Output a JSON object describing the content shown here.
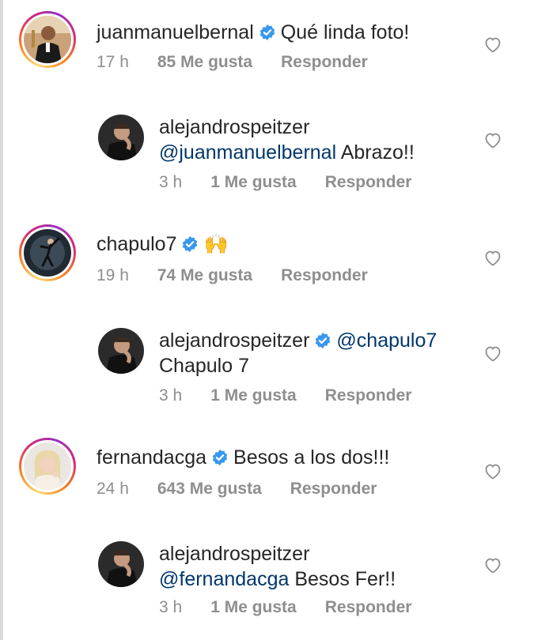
{
  "comments": [
    {
      "username": "juanmanuelbernal",
      "verified": true,
      "text": "Qué linda foto!",
      "time": "17 h",
      "likes": "85 Me gusta",
      "reply": "Responder",
      "replies": [
        {
          "username": "alejandrospeitzer",
          "verified": false,
          "mention": "@juanmanuelbernal",
          "text": "Abrazo!!",
          "time": "3 h",
          "likes": "1 Me gusta",
          "reply": "Responder"
        }
      ]
    },
    {
      "username": "chapulo7",
      "verified": true,
      "text": "🙌",
      "time": "19 h",
      "likes": "74 Me gusta",
      "reply": "Responder",
      "replies": [
        {
          "username": "alejandrospeitzer",
          "verified": true,
          "mention": "@chapulo7",
          "text": "Chapulo 7",
          "time": "3 h",
          "likes": "1 Me gusta",
          "reply": "Responder"
        }
      ]
    },
    {
      "username": "fernandacga",
      "verified": true,
      "text": "Besos a los dos!!!",
      "time": "24 h",
      "likes": "643 Me gusta",
      "reply": "Responder",
      "replies": [
        {
          "username": "alejandrospeitzer",
          "verified": false,
          "mention": "@fernandacga",
          "text": "Besos Fer!!",
          "time": "3 h",
          "likes": "1 Me gusta",
          "reply": "Responder"
        }
      ]
    }
  ],
  "colors": {
    "verified": "#3897f0",
    "mention": "#00376b",
    "meta": "#8e8e8e"
  },
  "icons": {
    "like": "heart-outline-icon",
    "verified": "verified-badge-icon"
  }
}
